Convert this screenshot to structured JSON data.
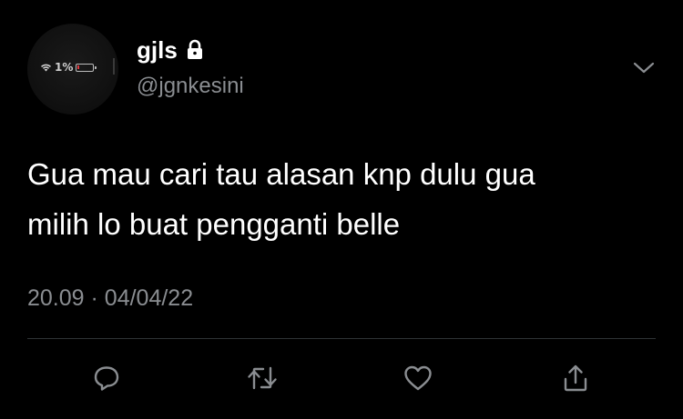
{
  "tweet": {
    "avatar": {
      "status_text": "1%",
      "battery_color": "#e0383e"
    },
    "author": {
      "display_name": "gjls",
      "handle": "@jgnkesini",
      "protected_icon": "lock-icon"
    },
    "text_line1": "Gua mau cari tau alasan knp dulu gua",
    "text_line2": "milih lo buat pengganti belle",
    "time": "20.09",
    "separator": "·",
    "date": "04/04/22",
    "menu_icon": "chevron-down-icon",
    "actions": [
      {
        "icon": "reply-icon"
      },
      {
        "icon": "retweet-icon"
      },
      {
        "icon": "like-icon"
      },
      {
        "icon": "share-icon"
      }
    ]
  },
  "colors": {
    "background": "#000000",
    "primary_text": "#ffffff",
    "secondary_text": "#8a8d91",
    "divider": "#2f3336",
    "icon": "#8a8d91"
  }
}
